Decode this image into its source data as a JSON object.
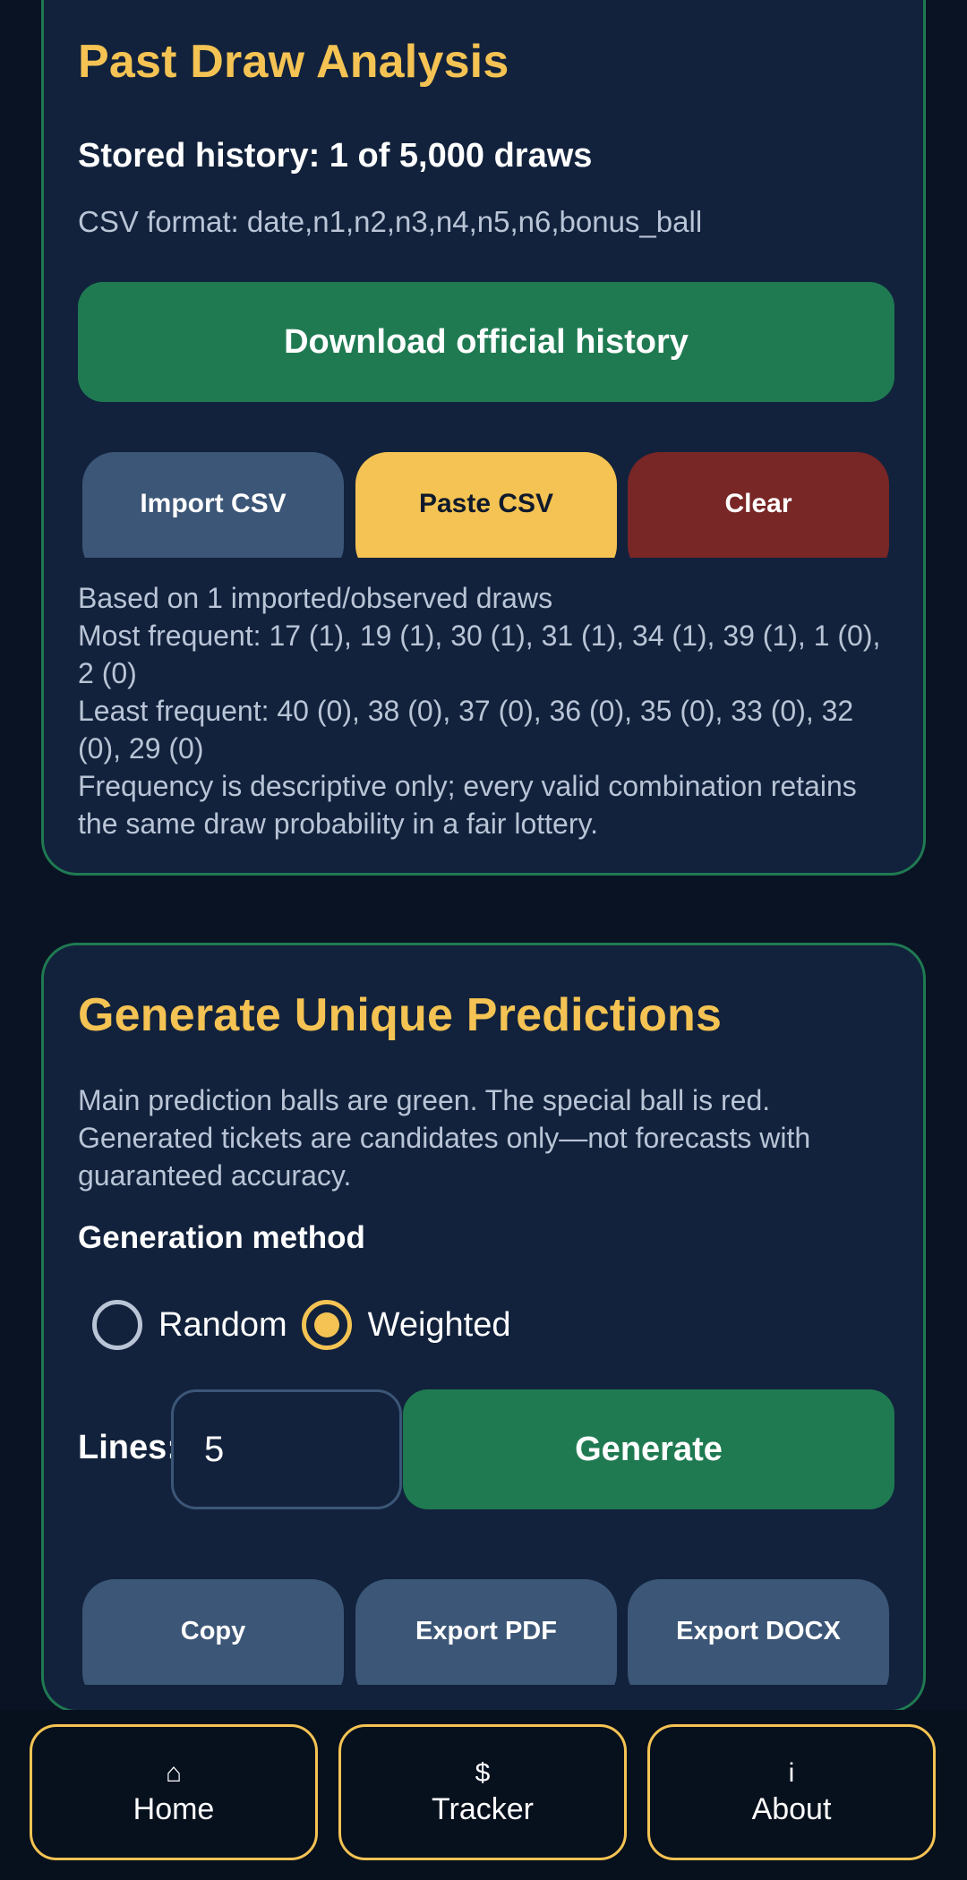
{
  "analysis_card": {
    "title": "Past Draw Analysis",
    "stored_history": "Stored history: 1 of 5,000 draws",
    "csv_format": "CSV format: date,n1,n2,n3,n4,n5,n6,bonus_ball",
    "download_label": "Download official history",
    "import_label": "Import CSV",
    "paste_label": "Paste CSV",
    "clear_label": "Clear",
    "based_on": "Based on 1 imported/observed draws",
    "most_frequent": "Most frequent: 17 (1), 19 (1), 30 (1), 31 (1), 34 (1), 39 (1), 1 (0), 2 (0)",
    "least_frequent": "Least frequent: 40 (0), 38 (0), 37 (0), 36 (0), 35 (0), 33 (0), 32 (0), 29 (0)",
    "disclaimer": "Frequency is descriptive only; every valid combination retains the same draw probability in a fair lottery."
  },
  "generate_card": {
    "title": "Generate Unique Predictions",
    "description": "Main prediction balls are green. The special ball is red. Generated tickets are candidates only—not forecasts with guaranteed accuracy.",
    "method_label": "Generation method",
    "method_options": [
      "Random",
      "Weighted"
    ],
    "method_selected": "Weighted",
    "lines_label": "Lines:",
    "lines_value": "5",
    "generate_label": "Generate",
    "copy_label": "Copy",
    "export_pdf_label": "Export PDF",
    "export_docx_label": "Export DOCX"
  },
  "bottom_nav": {
    "items": [
      {
        "icon": "⌂",
        "icon_name": "home-icon",
        "label": "Home"
      },
      {
        "icon": "$",
        "icon_name": "dollar-icon",
        "label": "Tracker"
      },
      {
        "icon": "i",
        "icon_name": "info-icon",
        "label": "About"
      }
    ]
  },
  "colors": {
    "background": "#0a1323",
    "card": "#12223c",
    "accent_gold": "#f4c353",
    "accent_green": "#1f7a52",
    "button_slate": "#3c5677",
    "button_red": "#782626"
  }
}
